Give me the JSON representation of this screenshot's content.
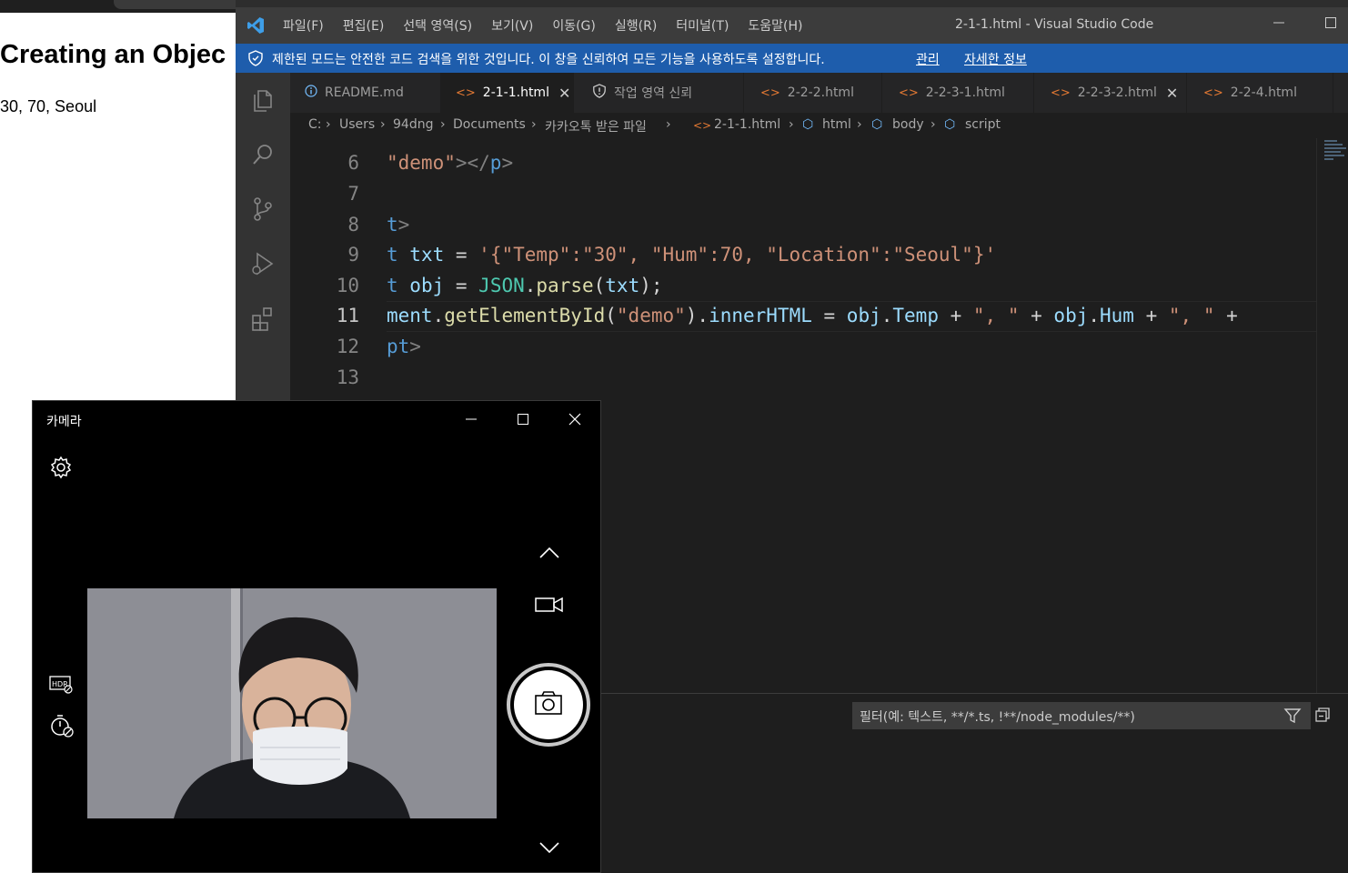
{
  "browser": {
    "heading": "Creating an Objec",
    "output": "30, 70, Seoul"
  },
  "vscode": {
    "menu": [
      "파일(F)",
      "편집(E)",
      "선택 영역(S)",
      "보기(V)",
      "이동(G)",
      "실행(R)",
      "터미널(T)",
      "도움말(H)"
    ],
    "window_title": "2-1-1.html - Visual Studio Code",
    "banner": {
      "message": "제한된 모드는 안전한 코드 검색을 위한 것입니다. 이 창을 신뢰하여 모든 기능을 사용하도록 설정합니다.",
      "manage_link": "관리",
      "details_link": "자세한 정보"
    },
    "tabs": [
      {
        "label": "README.md",
        "icon": "info-icon"
      },
      {
        "label": "2-1-1.html",
        "icon": "html-icon",
        "active": true
      },
      {
        "label": "작업 영역 신뢰",
        "icon": "shield-icon"
      },
      {
        "label": "2-2-2.html",
        "icon": "html-icon"
      },
      {
        "label": "2-2-3-1.html",
        "icon": "html-icon"
      },
      {
        "label": "2-2-3-2.html",
        "icon": "html-icon"
      },
      {
        "label": "2-2-4.html",
        "icon": "html-icon"
      }
    ],
    "breadcrumb": [
      "C:",
      "Users",
      "94dng",
      "Documents",
      "카카오톡 받은 파일",
      "2-1-1.html",
      "html",
      "body",
      "script"
    ],
    "line_numbers": [
      "6",
      "7",
      "8",
      "9",
      "10",
      "11",
      "12",
      "13"
    ],
    "current_line": "11",
    "code": {
      "l6_a": "\"demo\"",
      "l6_b": "></",
      "l6_c": "p",
      "l6_d": ">",
      "l8_a": "t",
      "l8_b": ">",
      "l9_a": "t ",
      "l9_b": "txt",
      "l9_c": " = ",
      "l9_d": "'{\"Temp\":\"30\", \"Hum\":70, \"Location\":\"Seoul\"}'",
      "l10_a": "t ",
      "l10_b": "obj",
      "l10_c": " = ",
      "l10_d": "JSON",
      "l10_e": ".",
      "l10_f": "parse",
      "l10_g": "(",
      "l10_h": "txt",
      "l10_i": ");",
      "l11_a": "ment",
      "l11_b": ".",
      "l11_c": "getElementById",
      "l11_d": "(",
      "l11_e": "\"demo\"",
      "l11_f": ").",
      "l11_g": "innerHTML",
      "l11_h": " = ",
      "l11_i": "obj",
      "l11_j": ".",
      "l11_k": "Temp",
      "l11_l": " + ",
      "l11_m": "\", \"",
      "l11_n": " + ",
      "l11_o": "obj",
      "l11_p": ".",
      "l11_q": "Hum",
      "l11_r": " + ",
      "l11_s": "\", \"",
      "l11_t": " +",
      "l12_a": "pt",
      "l12_b": ">"
    },
    "filter_placeholder": "필터(예: 텍스트, **/*.ts, !**/node_modules/**)"
  },
  "camera": {
    "title": "카메라"
  },
  "colors": {
    "banner_bg": "#1e5dac",
    "editor_bg": "#1e1e1e",
    "activitybar_bg": "#333333"
  }
}
